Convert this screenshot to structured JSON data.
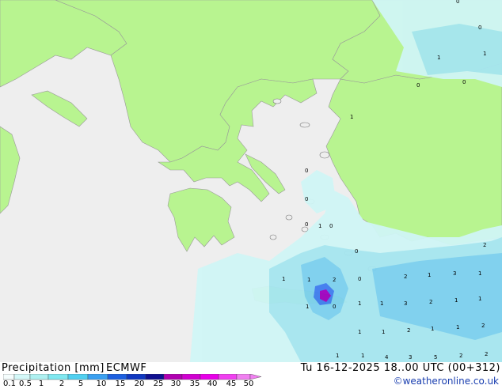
{
  "header": {
    "title": "Precipitation [mm]",
    "model": "ECMWF",
    "datetime": "Tu 16-12-2025 18..00 UTC (00+312)",
    "credit": "©weatheronline.co.uk"
  },
  "legend": {
    "ticks": [
      "0.1",
      "0.5",
      "1",
      "2",
      "5",
      "10",
      "15",
      "20",
      "25",
      "30",
      "35",
      "40",
      "45",
      "50"
    ],
    "colors": [
      "#f5fdfd",
      "#d4f8f8",
      "#aef0f0",
      "#80e8f0",
      "#50d0f0",
      "#3aa0f0",
      "#1d60e0",
      "#1038c0",
      "#101090",
      "#b000b0",
      "#d000d0",
      "#e800e8",
      "#f040f0",
      "#f080f0"
    ]
  },
  "colors": {
    "land": "#b8f490",
    "sea": "#eeeeee",
    "precip_light": "#d0f6f6",
    "precip_mid": "#a6e6f0",
    "precip_strong": "#7cd0ee",
    "precip_core": "#3f7cf0",
    "precip_peak": "#a000c0"
  },
  "map": {
    "region": "Aegean Sea / Balkans / Western Turkey",
    "value_labels": [
      {
        "text": "0"
      },
      {
        "text": "0"
      },
      {
        "text": "1"
      },
      {
        "text": "1"
      },
      {
        "text": "0"
      },
      {
        "text": "0"
      },
      {
        "text": "1"
      },
      {
        "text": "0"
      },
      {
        "text": "0"
      },
      {
        "text": "0"
      },
      {
        "text": "1"
      },
      {
        "text": "0"
      },
      {
        "text": "0"
      },
      {
        "text": "1"
      },
      {
        "text": "1"
      },
      {
        "text": "2"
      },
      {
        "text": "0"
      },
      {
        "text": "2"
      },
      {
        "text": "1"
      },
      {
        "text": "3"
      },
      {
        "text": "1"
      },
      {
        "text": "1"
      },
      {
        "text": "0"
      },
      {
        "text": "1"
      },
      {
        "text": "3"
      },
      {
        "text": "2"
      },
      {
        "text": "1"
      },
      {
        "text": "1"
      },
      {
        "text": "1"
      },
      {
        "text": "1"
      },
      {
        "text": "1"
      },
      {
        "text": "2"
      },
      {
        "text": "1"
      },
      {
        "text": "1"
      },
      {
        "text": "2"
      },
      {
        "text": "1"
      },
      {
        "text": "2"
      },
      {
        "text": "1"
      },
      {
        "text": "4"
      },
      {
        "text": "2"
      },
      {
        "text": "5"
      },
      {
        "text": "3"
      },
      {
        "text": "2"
      }
    ]
  }
}
